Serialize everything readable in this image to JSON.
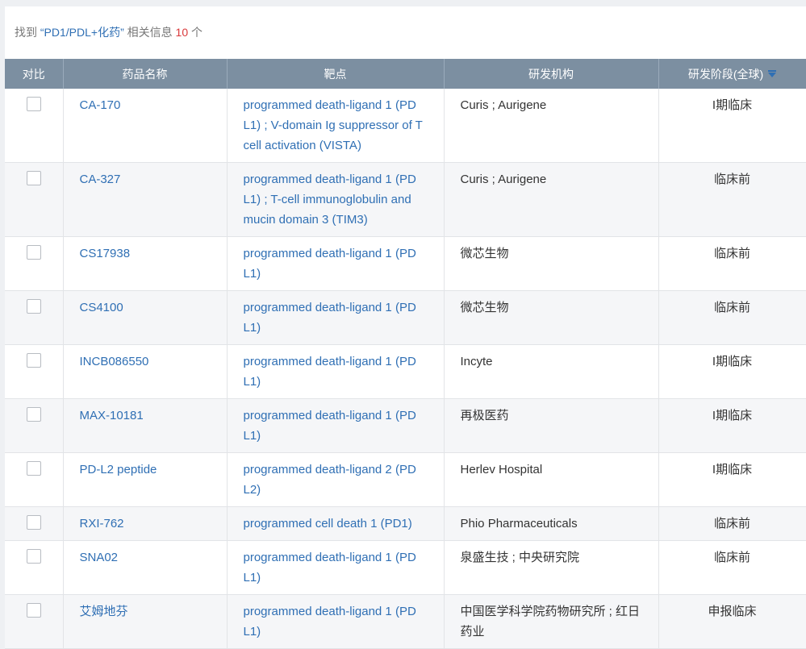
{
  "summary": {
    "prefix": "找到",
    "query": "“PD1/PDL+化药”",
    "middle": "相关信息",
    "count": "10",
    "suffix": "个"
  },
  "columns": {
    "compare": "对比",
    "name": "药品名称",
    "target": "靶点",
    "org": "研发机构",
    "stage": "研发阶段(全球)"
  },
  "rows": [
    {
      "name": "CA-170",
      "target": "programmed death-ligand 1 (PD L1) ; V-domain Ig suppressor of T cell activation (VISTA)",
      "org": "Curis ; Aurigene",
      "stage": "I期临床"
    },
    {
      "name": "CA-327",
      "target": "programmed death-ligand 1 (PD L1) ; T-cell immunoglobulin and mucin domain 3 (TIM3)",
      "org": "Curis ; Aurigene",
      "stage": "临床前"
    },
    {
      "name": "CS17938",
      "target": "programmed death-ligand 1 (PD L1)",
      "org": "微芯生物",
      "stage": "临床前"
    },
    {
      "name": "CS4100",
      "target": "programmed death-ligand 1 (PD L1)",
      "org": "微芯生物",
      "stage": "临床前"
    },
    {
      "name": "INCB086550",
      "target": "programmed death-ligand 1 (PD L1)",
      "org": "Incyte",
      "stage": "I期临床"
    },
    {
      "name": "MAX-10181",
      "target": "programmed death-ligand 1 (PD L1)",
      "org": "再极医药",
      "stage": "I期临床"
    },
    {
      "name": "PD-L2 peptide",
      "target": "programmed death-ligand 2 (PD L2)",
      "org": "Herlev Hospital",
      "stage": "I期临床"
    },
    {
      "name": "RXI-762",
      "target": "programmed cell death 1 (PD1)",
      "org": "Phio Pharmaceuticals",
      "stage": "临床前"
    },
    {
      "name": "SNA02",
      "target": "programmed death-ligand 1 (PD L1)",
      "org": "泉盛生技 ; 中央研究院",
      "stage": "临床前"
    },
    {
      "name": "艾姆地芬",
      "target": "programmed death-ligand 1 (PD L1)",
      "org": "中国医学科学院药物研究所 ; 红日药业",
      "stage": "申报临床"
    }
  ]
}
